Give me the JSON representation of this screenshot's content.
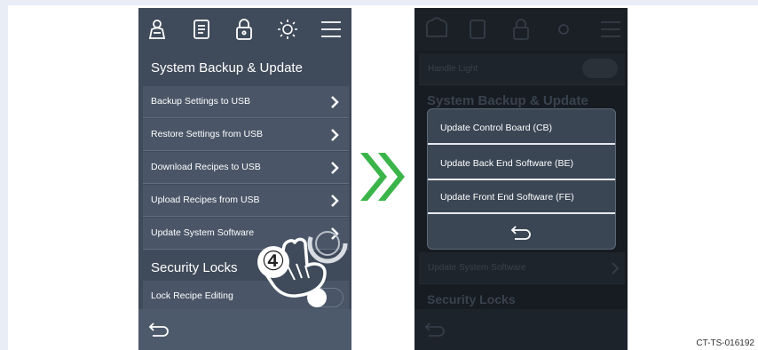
{
  "left_screen": {
    "top_icons": [
      "chef-user-icon",
      "recipe-book-icon",
      "lock-icon",
      "brightness-icon",
      "menu-icon"
    ],
    "backup_heading": "System Backup & Update",
    "items": [
      {
        "label": "Backup Settings to USB"
      },
      {
        "label": "Restore Settings from USB"
      },
      {
        "label": "Download Recipes to USB"
      },
      {
        "label": "Upload Recipes from USB"
      },
      {
        "label": "Update System Software"
      }
    ],
    "security_heading": "Security Locks",
    "lock_recipe_label": "Lock Recipe Editing",
    "step_number": "④"
  },
  "right_screen": {
    "background": {
      "handle_light": "Handle Light",
      "backup_heading": "System Backup & Update",
      "update_software": "Update System Software",
      "security_heading": "Security Locks"
    },
    "dialog": {
      "options": [
        {
          "label": "Update Control Board (CB)"
        },
        {
          "label": "Update Back End Software (BE)"
        },
        {
          "label": "Update Front End Software (FE)"
        }
      ]
    }
  },
  "doc_code": "CT-TS-016192",
  "colors": {
    "accent_green": "#3bb54a",
    "panel": "#3f4a5a"
  }
}
